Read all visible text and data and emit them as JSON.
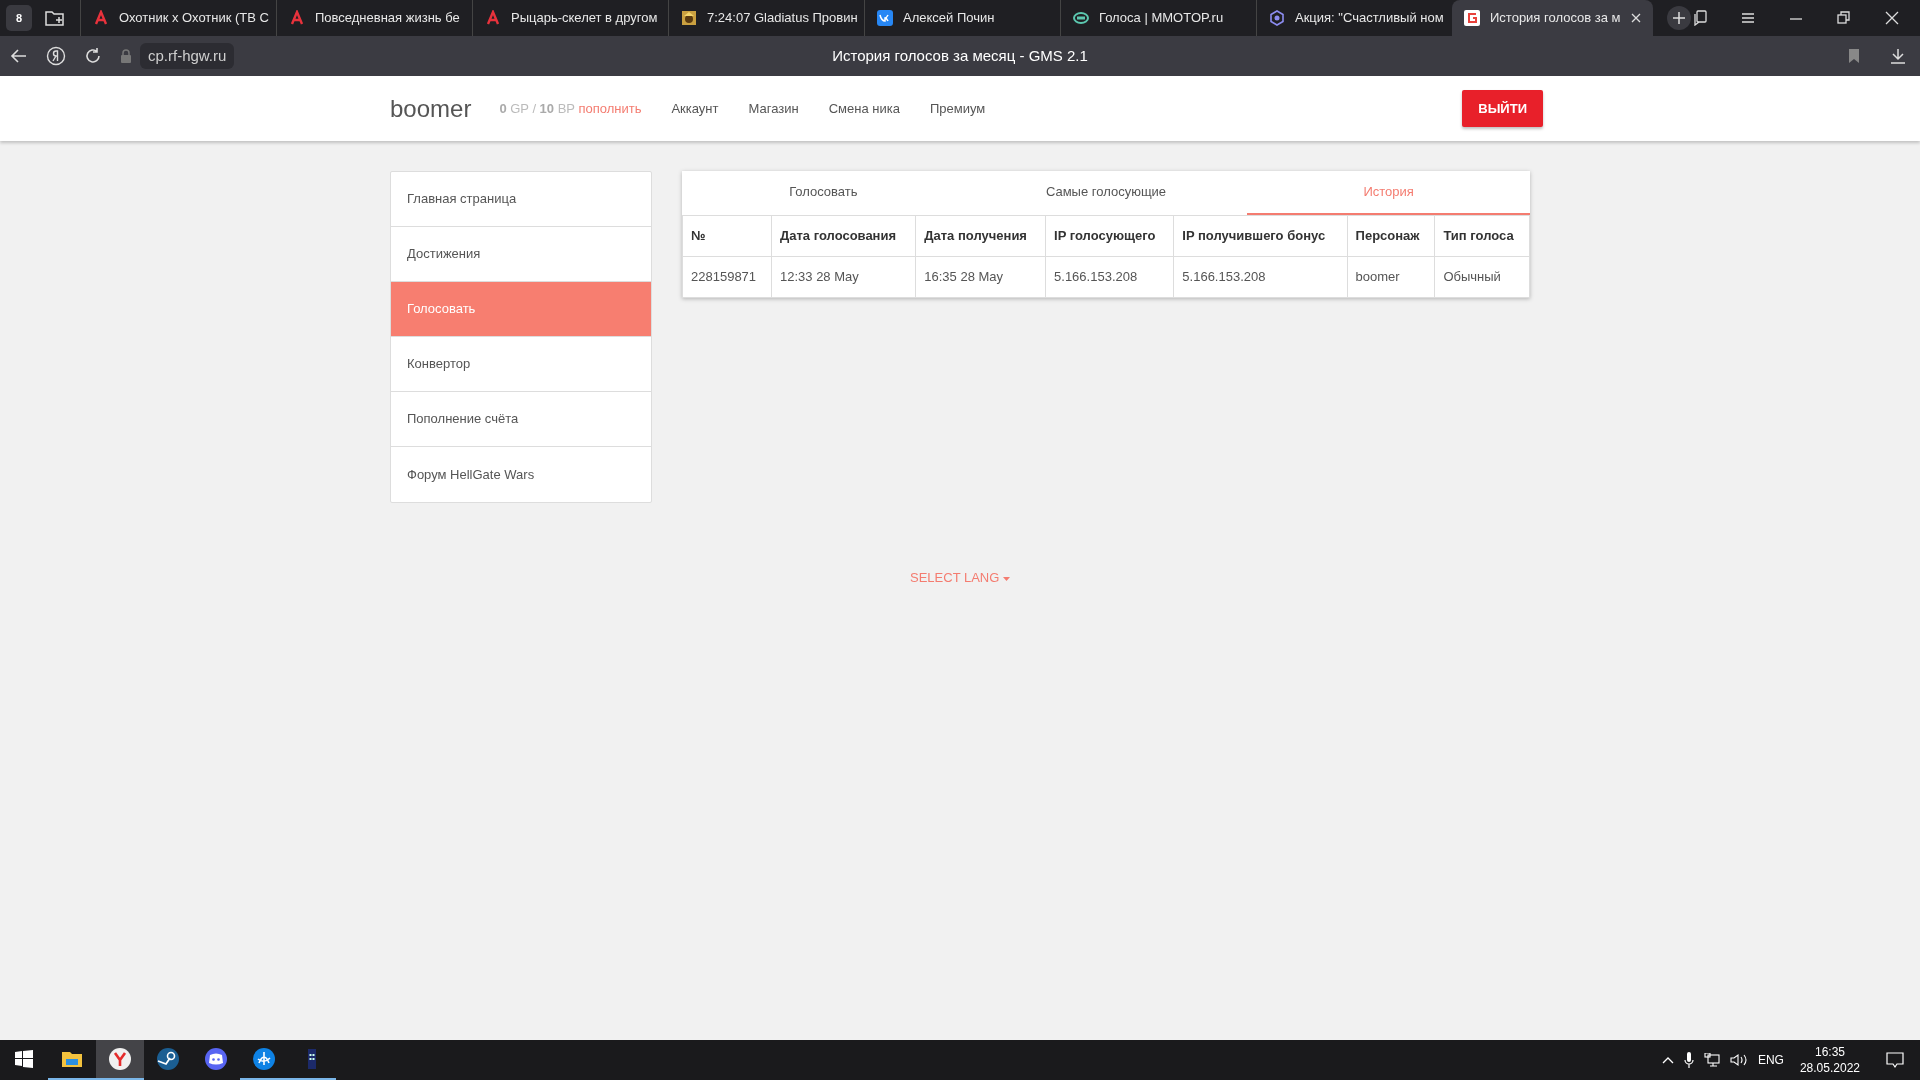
{
  "browser": {
    "tab_count": "8",
    "tabs": [
      {
        "kind": "letter",
        "title": "Охотник х Охотник (ТВ С",
        "selected": false
      },
      {
        "kind": "letter",
        "title": "Повседневная жизнь бе",
        "selected": false
      },
      {
        "kind": "letter",
        "title": "Рыцарь-скелет в другом",
        "selected": false
      },
      {
        "kind": "game",
        "title": "7:24:07 Gladiatus Провин",
        "selected": false
      },
      {
        "kind": "vk",
        "title": "Алексей Почин",
        "selected": false
      },
      {
        "kind": "eye",
        "title": "Голоса | MMOTOP.ru",
        "selected": false
      },
      {
        "kind": "hex",
        "title": "Акция: \"Счастливый ном",
        "selected": false
      },
      {
        "kind": "site",
        "title": "История голосов за м",
        "selected": true
      }
    ],
    "address": "cp.rf-hgw.ru",
    "page_title": "История голосов за месяц - GMS 2.1"
  },
  "header": {
    "username": "boomer",
    "gp_value": "0",
    "gp_unit": "GP /",
    "bp_value": "10",
    "bp_unit": "BP",
    "topup_link": "пополнить",
    "nav": [
      "Аккаунт",
      "Магазин",
      "Смена ника",
      "Премиум"
    ],
    "logout": "ВЫЙТИ"
  },
  "sidebar": {
    "items": [
      {
        "label": "Главная страница",
        "selected": false
      },
      {
        "label": "Достижения",
        "selected": false
      },
      {
        "label": "Голосовать",
        "selected": true
      },
      {
        "label": "Конвертор",
        "selected": false
      },
      {
        "label": "Пополнение счёта",
        "selected": false
      },
      {
        "label": "Форум HellGate Wars",
        "selected": false
      }
    ]
  },
  "vote_tabs": [
    {
      "label": "Голосовать",
      "selected": false
    },
    {
      "label": "Самые голосующие",
      "selected": false
    },
    {
      "label": "История",
      "selected": true
    }
  ],
  "table": {
    "columns": [
      "№",
      "Дата голосования",
      "Дата получения",
      "IP голосующего",
      "IP получившего бонус",
      "Персонаж",
      "Тип голоса"
    ],
    "rows": [
      [
        "228159871",
        "12:33 28 May",
        "16:35 28 May",
        "5.166.153.208",
        "5.166.153.208",
        "boomer",
        "Обычный"
      ]
    ]
  },
  "footer": {
    "select_lang": "SELECT LANG"
  },
  "taskbar": {
    "apps": [
      {
        "kind": "folder",
        "running": true,
        "selected": false
      },
      {
        "kind": "yandex",
        "running": true,
        "selected": true
      },
      {
        "kind": "steam",
        "running": false,
        "selected": false
      },
      {
        "kind": "discord",
        "running": false,
        "selected": false
      },
      {
        "kind": "battlenet",
        "running": true,
        "selected": false
      },
      {
        "kind": "booth",
        "running": true,
        "selected": false
      }
    ],
    "language": "ENG",
    "time": "16:35",
    "date": "28.05.2022"
  }
}
